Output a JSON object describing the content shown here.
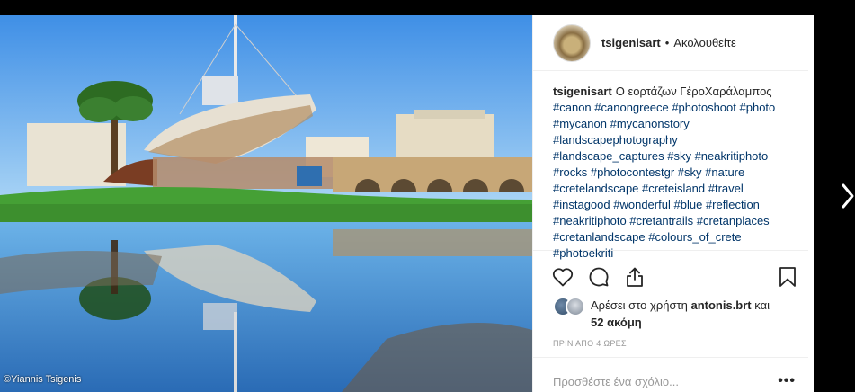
{
  "post": {
    "username": "tsigenisart",
    "separator": "•",
    "follow_status": "Ακολουθείτε",
    "photo_credit": "©Yiannis Tsigenis"
  },
  "caption": {
    "username": "tsigenisart",
    "text": "Ο εορτάζων ΓέροΧαράλαμπος",
    "hashtags": [
      "#canon",
      "#canongreece",
      "#photoshoot",
      "#photo",
      "#mycanon",
      "#mycanonstory",
      "#landscapephotography",
      "#landscape_captures",
      "#sky",
      "#neakritiphoto",
      "#rocks",
      "#photocontestgr",
      "#sky",
      "#nature",
      "#cretelandscape",
      "#creteisland",
      "#travel",
      "#instagood",
      "#wonderful",
      "#blue",
      "#reflection",
      "#neakritiphoto",
      "#cretantrails",
      "#cretanplaces",
      "#cretanlandscape",
      "#colours_of_crete",
      "#photoekriti"
    ]
  },
  "actions": {
    "like_icon": "heart-icon",
    "comment_icon": "comment-icon",
    "share_icon": "share-icon",
    "save_icon": "bookmark-icon"
  },
  "likes": {
    "prefix": "Αρέσει στο χρήστη",
    "user": "antonis.brt",
    "suffix": "και",
    "others": "52 ακόμη"
  },
  "timestamp": "ΠΡΙΝ ΑΠΟ 4 ΩΡΕΣ",
  "comment": {
    "placeholder": "Προσθέστε ένα σχόλιο...",
    "more_label": "•••"
  },
  "colors": {
    "hashtag": "#003569",
    "text": "#262626",
    "muted": "#999999"
  }
}
